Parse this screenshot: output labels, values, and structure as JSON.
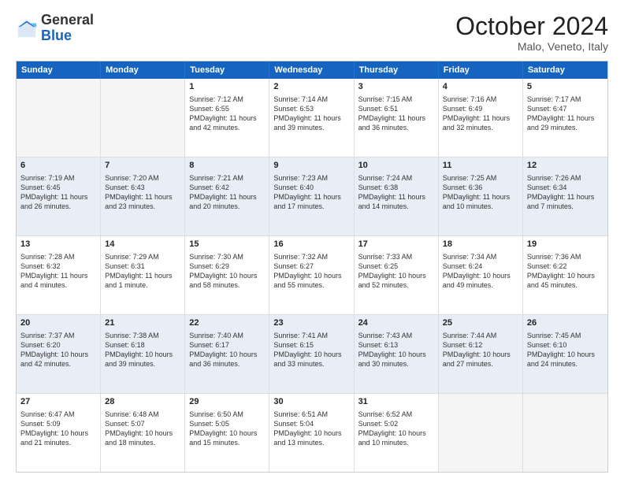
{
  "logo": {
    "text_general": "General",
    "text_blue": "Blue"
  },
  "header": {
    "month": "October 2024",
    "location": "Malo, Veneto, Italy"
  },
  "days_of_week": [
    "Sunday",
    "Monday",
    "Tuesday",
    "Wednesday",
    "Thursday",
    "Friday",
    "Saturday"
  ],
  "weeks": [
    [
      {
        "day": "",
        "empty": true
      },
      {
        "day": "",
        "empty": true
      },
      {
        "day": "1",
        "line1": "Sunrise: 7:12 AM",
        "line2": "Sunset: 6:55 PM",
        "line3": "Daylight: 11 hours",
        "line4": "and 42 minutes."
      },
      {
        "day": "2",
        "line1": "Sunrise: 7:14 AM",
        "line2": "Sunset: 6:53 PM",
        "line3": "Daylight: 11 hours",
        "line4": "and 39 minutes."
      },
      {
        "day": "3",
        "line1": "Sunrise: 7:15 AM",
        "line2": "Sunset: 6:51 PM",
        "line3": "Daylight: 11 hours",
        "line4": "and 36 minutes."
      },
      {
        "day": "4",
        "line1": "Sunrise: 7:16 AM",
        "line2": "Sunset: 6:49 PM",
        "line3": "Daylight: 11 hours",
        "line4": "and 32 minutes."
      },
      {
        "day": "5",
        "line1": "Sunrise: 7:17 AM",
        "line2": "Sunset: 6:47 PM",
        "line3": "Daylight: 11 hours",
        "line4": "and 29 minutes."
      }
    ],
    [
      {
        "day": "6",
        "line1": "Sunrise: 7:19 AM",
        "line2": "Sunset: 6:45 PM",
        "line3": "Daylight: 11 hours",
        "line4": "and 26 minutes."
      },
      {
        "day": "7",
        "line1": "Sunrise: 7:20 AM",
        "line2": "Sunset: 6:43 PM",
        "line3": "Daylight: 11 hours",
        "line4": "and 23 minutes."
      },
      {
        "day": "8",
        "line1": "Sunrise: 7:21 AM",
        "line2": "Sunset: 6:42 PM",
        "line3": "Daylight: 11 hours",
        "line4": "and 20 minutes."
      },
      {
        "day": "9",
        "line1": "Sunrise: 7:23 AM",
        "line2": "Sunset: 6:40 PM",
        "line3": "Daylight: 11 hours",
        "line4": "and 17 minutes."
      },
      {
        "day": "10",
        "line1": "Sunrise: 7:24 AM",
        "line2": "Sunset: 6:38 PM",
        "line3": "Daylight: 11 hours",
        "line4": "and 14 minutes."
      },
      {
        "day": "11",
        "line1": "Sunrise: 7:25 AM",
        "line2": "Sunset: 6:36 PM",
        "line3": "Daylight: 11 hours",
        "line4": "and 10 minutes."
      },
      {
        "day": "12",
        "line1": "Sunrise: 7:26 AM",
        "line2": "Sunset: 6:34 PM",
        "line3": "Daylight: 11 hours",
        "line4": "and 7 minutes."
      }
    ],
    [
      {
        "day": "13",
        "line1": "Sunrise: 7:28 AM",
        "line2": "Sunset: 6:32 PM",
        "line3": "Daylight: 11 hours",
        "line4": "and 4 minutes."
      },
      {
        "day": "14",
        "line1": "Sunrise: 7:29 AM",
        "line2": "Sunset: 6:31 PM",
        "line3": "Daylight: 11 hours",
        "line4": "and 1 minute."
      },
      {
        "day": "15",
        "line1": "Sunrise: 7:30 AM",
        "line2": "Sunset: 6:29 PM",
        "line3": "Daylight: 10 hours",
        "line4": "and 58 minutes."
      },
      {
        "day": "16",
        "line1": "Sunrise: 7:32 AM",
        "line2": "Sunset: 6:27 PM",
        "line3": "Daylight: 10 hours",
        "line4": "and 55 minutes."
      },
      {
        "day": "17",
        "line1": "Sunrise: 7:33 AM",
        "line2": "Sunset: 6:25 PM",
        "line3": "Daylight: 10 hours",
        "line4": "and 52 minutes."
      },
      {
        "day": "18",
        "line1": "Sunrise: 7:34 AM",
        "line2": "Sunset: 6:24 PM",
        "line3": "Daylight: 10 hours",
        "line4": "and 49 minutes."
      },
      {
        "day": "19",
        "line1": "Sunrise: 7:36 AM",
        "line2": "Sunset: 6:22 PM",
        "line3": "Daylight: 10 hours",
        "line4": "and 45 minutes."
      }
    ],
    [
      {
        "day": "20",
        "line1": "Sunrise: 7:37 AM",
        "line2": "Sunset: 6:20 PM",
        "line3": "Daylight: 10 hours",
        "line4": "and 42 minutes."
      },
      {
        "day": "21",
        "line1": "Sunrise: 7:38 AM",
        "line2": "Sunset: 6:18 PM",
        "line3": "Daylight: 10 hours",
        "line4": "and 39 minutes."
      },
      {
        "day": "22",
        "line1": "Sunrise: 7:40 AM",
        "line2": "Sunset: 6:17 PM",
        "line3": "Daylight: 10 hours",
        "line4": "and 36 minutes."
      },
      {
        "day": "23",
        "line1": "Sunrise: 7:41 AM",
        "line2": "Sunset: 6:15 PM",
        "line3": "Daylight: 10 hours",
        "line4": "and 33 minutes."
      },
      {
        "day": "24",
        "line1": "Sunrise: 7:43 AM",
        "line2": "Sunset: 6:13 PM",
        "line3": "Daylight: 10 hours",
        "line4": "and 30 minutes."
      },
      {
        "day": "25",
        "line1": "Sunrise: 7:44 AM",
        "line2": "Sunset: 6:12 PM",
        "line3": "Daylight: 10 hours",
        "line4": "and 27 minutes."
      },
      {
        "day": "26",
        "line1": "Sunrise: 7:45 AM",
        "line2": "Sunset: 6:10 PM",
        "line3": "Daylight: 10 hours",
        "line4": "and 24 minutes."
      }
    ],
    [
      {
        "day": "27",
        "line1": "Sunrise: 6:47 AM",
        "line2": "Sunset: 5:09 PM",
        "line3": "Daylight: 10 hours",
        "line4": "and 21 minutes."
      },
      {
        "day": "28",
        "line1": "Sunrise: 6:48 AM",
        "line2": "Sunset: 5:07 PM",
        "line3": "Daylight: 10 hours",
        "line4": "and 18 minutes."
      },
      {
        "day": "29",
        "line1": "Sunrise: 6:50 AM",
        "line2": "Sunset: 5:05 PM",
        "line3": "Daylight: 10 hours",
        "line4": "and 15 minutes."
      },
      {
        "day": "30",
        "line1": "Sunrise: 6:51 AM",
        "line2": "Sunset: 5:04 PM",
        "line3": "Daylight: 10 hours",
        "line4": "and 13 minutes."
      },
      {
        "day": "31",
        "line1": "Sunrise: 6:52 AM",
        "line2": "Sunset: 5:02 PM",
        "line3": "Daylight: 10 hours",
        "line4": "and 10 minutes."
      },
      {
        "day": "",
        "empty": true
      },
      {
        "day": "",
        "empty": true
      }
    ]
  ]
}
